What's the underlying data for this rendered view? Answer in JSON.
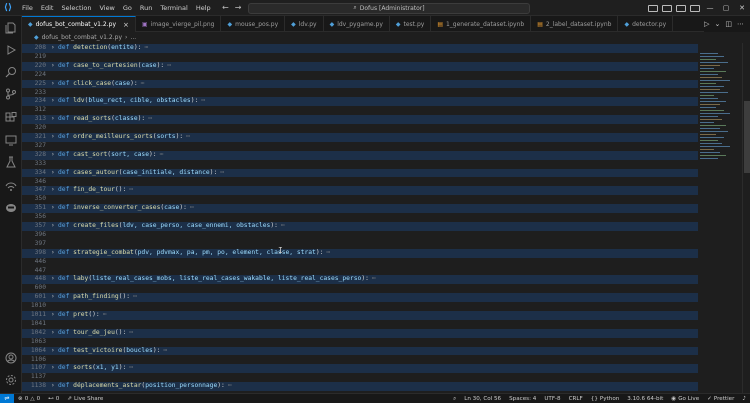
{
  "titlebar": {
    "menu": [
      "File",
      "Edit",
      "Selection",
      "View",
      "Go",
      "Run",
      "Terminal",
      "Help"
    ],
    "search_text": "Dofus [Administrator]"
  },
  "tabs": [
    {
      "label": "dofus_bot_combat_v1.2.py",
      "icon": "python-file-icon",
      "active": true
    },
    {
      "label": "image_vierge_pil.png",
      "icon": "image-file-icon"
    },
    {
      "label": "mouse_pos.py",
      "icon": "python-file-icon"
    },
    {
      "label": "ldv.py",
      "icon": "python-file-icon"
    },
    {
      "label": "ldv_pygame.py",
      "icon": "python-file-icon"
    },
    {
      "label": "test.py",
      "icon": "python-file-icon"
    },
    {
      "label": "1_generate_dataset.ipynb",
      "icon": "notebook-file-icon"
    },
    {
      "label": "2_label_dataset.ipynb",
      "icon": "notebook-file-icon"
    },
    {
      "label": "detector.py",
      "icon": "python-file-icon"
    }
  ],
  "breadcrumb": {
    "file": "dofus_bot_combat_v1.2.py",
    "rest": "..."
  },
  "editor": {
    "lines": [
      {
        "n": "208",
        "fold": true,
        "name": "detection",
        "params": "entite"
      },
      {
        "n": "219",
        "fold": false
      },
      {
        "n": "220",
        "fold": true,
        "name": "case_to_cartesien",
        "params": "case"
      },
      {
        "n": "224",
        "fold": false
      },
      {
        "n": "225",
        "fold": true,
        "name": "click_case",
        "params": "case"
      },
      {
        "n": "233",
        "fold": false
      },
      {
        "n": "234",
        "fold": true,
        "name": "ldv",
        "params": "blue_rect, cible, obstacles"
      },
      {
        "n": "312",
        "fold": false
      },
      {
        "n": "313",
        "fold": true,
        "name": "read_sorts",
        "params": "classe"
      },
      {
        "n": "320",
        "fold": false
      },
      {
        "n": "321",
        "fold": true,
        "name": "ordre_meilleurs_sorts",
        "params": "sorts"
      },
      {
        "n": "327",
        "fold": false
      },
      {
        "n": "328",
        "fold": true,
        "name": "cast_sort",
        "params": "sort, case"
      },
      {
        "n": "333",
        "fold": false
      },
      {
        "n": "334",
        "fold": true,
        "name": "cases_autour",
        "params": "case_initiale, distance"
      },
      {
        "n": "346",
        "fold": false
      },
      {
        "n": "347",
        "fold": true,
        "name": "fin_de_tour",
        "params": ""
      },
      {
        "n": "350",
        "fold": false
      },
      {
        "n": "351",
        "fold": true,
        "name": "inverse_converter_cases",
        "params": "case"
      },
      {
        "n": "356",
        "fold": false
      },
      {
        "n": "357",
        "fold": true,
        "name": "create_files",
        "params": "ldv, case_perso, case_ennemi, obstacles"
      },
      {
        "n": "396",
        "fold": false
      },
      {
        "n": "397",
        "fold": false
      },
      {
        "n": "398",
        "fold": true,
        "name": "strategie_combat",
        "params": "pdv, pdvmax, pa, pm, po, element, classe, strat"
      },
      {
        "n": "446",
        "fold": false
      },
      {
        "n": "447",
        "fold": false
      },
      {
        "n": "448",
        "fold": true,
        "name": "laby",
        "params": "liste_real_cases_mobs, liste_real_cases_wakable, liste_real_cases_perso"
      },
      {
        "n": "600",
        "fold": false
      },
      {
        "n": "601",
        "fold": true,
        "name": "path_finding",
        "params": ""
      },
      {
        "n": "1010",
        "fold": false
      },
      {
        "n": "1011",
        "fold": true,
        "name": "pret",
        "params": ""
      },
      {
        "n": "1041",
        "fold": false
      },
      {
        "n": "1042",
        "fold": true,
        "name": "tour_de_jeu",
        "params": ""
      },
      {
        "n": "1063",
        "fold": false
      },
      {
        "n": "1064",
        "fold": true,
        "name": "test_victoire",
        "params": "boucles"
      },
      {
        "n": "1106",
        "fold": false
      },
      {
        "n": "1107",
        "fold": true,
        "name": "sorts",
        "params": "x1, y1"
      },
      {
        "n": "1137",
        "fold": false
      },
      {
        "n": "1138",
        "fold": true,
        "name": "déplacements_astar",
        "params": "position_personnage"
      }
    ]
  },
  "statusbar": {
    "errors": "0",
    "warnings": "0",
    "ports": "0",
    "live_share": "Live Share",
    "position": "Ln 30, Col 56",
    "spaces": "Spaces: 4",
    "encoding": "UTF-8",
    "eol": "CRLF",
    "language": "Python",
    "interpreter": "3.10.6 64-bit",
    "go_live": "Go Live",
    "prettier": "Prettier"
  },
  "colors": {
    "accent": "#0078d4",
    "fold_highlight": "#1c2f48",
    "keyword": "#569cd6",
    "function": "#dcdcaa",
    "param": "#9cdcfe"
  }
}
